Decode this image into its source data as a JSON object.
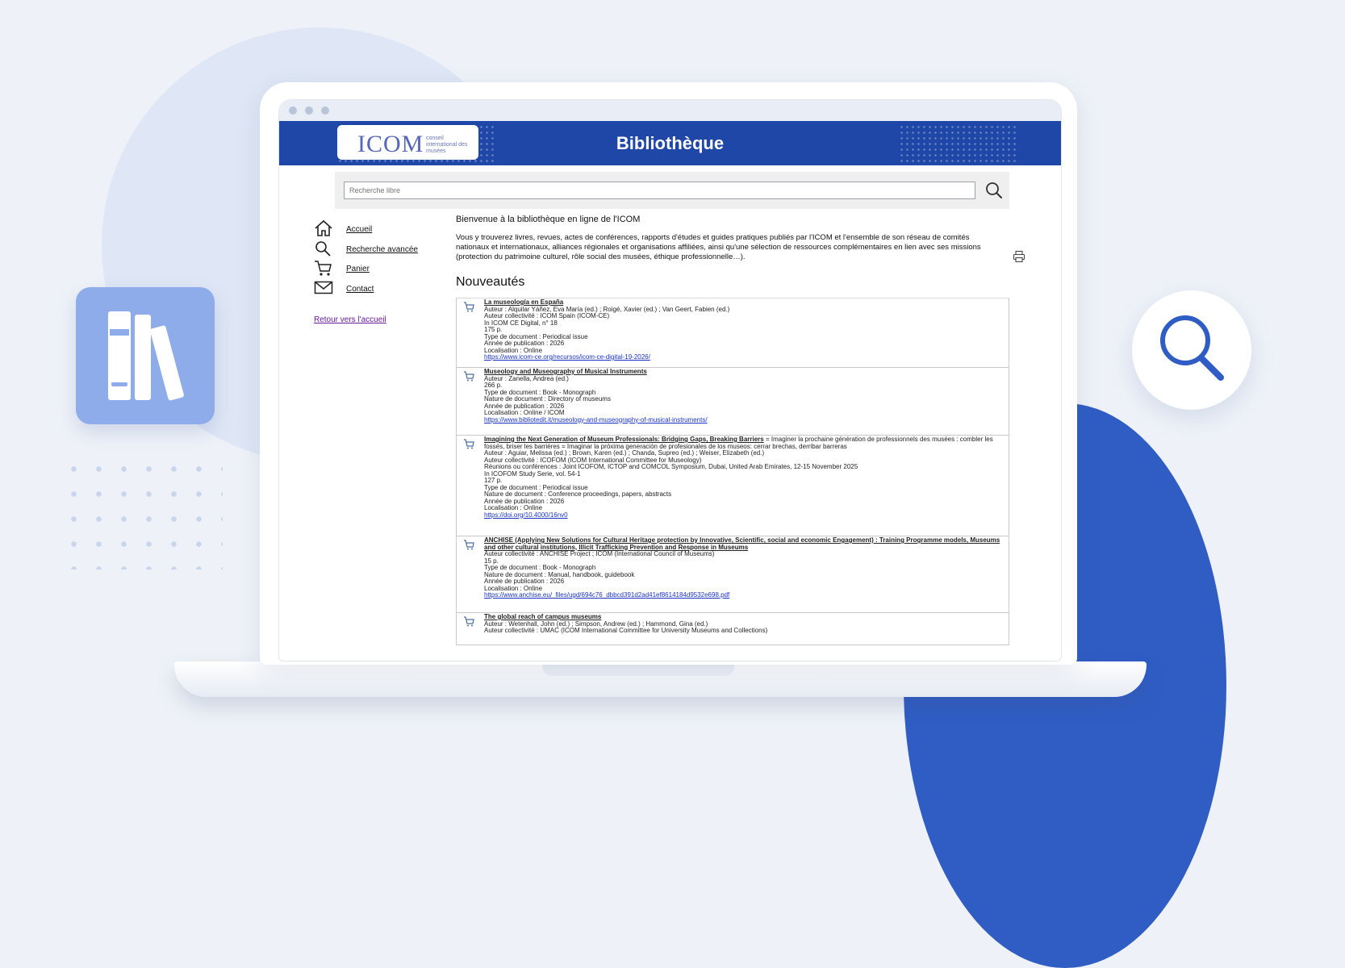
{
  "header": {
    "logo_text": "ICOM",
    "logo_sub": "conseil international des musées",
    "title": "Bibliothèque"
  },
  "search": {
    "placeholder": "Recherche libre"
  },
  "sidebar": {
    "items": [
      {
        "label": "Accueil",
        "icon": "home-icon"
      },
      {
        "label": "Recherche avancée",
        "icon": "search-icon"
      },
      {
        "label": "Panier",
        "icon": "cart-icon"
      },
      {
        "label": "Contact",
        "icon": "mail-icon"
      }
    ],
    "back_link": "Retour vers l'accueil"
  },
  "main": {
    "welcome": "Bienvenue à la bibliothèque en ligne de l'ICOM",
    "intro": "Vous y trouverez livres, revues, actes de conférences, rapports d'études et guides pratiques publiés par l'ICOM et l'ensemble de son réseau de comités nationaux et internationaux, alliances régionales et organisations affiliées, ainsi qu'une sélection de ressources complémentaires en lien avec ses missions (protection du patrimoine culturel, rôle social des musées, éthique professionnelle…).",
    "news_title": "Nouveautés"
  },
  "records": [
    {
      "title": "La museología en España",
      "title_suffix": "",
      "lines": [
        "Auteur : Alquilar Yáñez, Eva María (ed.) ; Roigé, Xavier (ed.) ; Van Geert, Fabien (ed.)",
        "Auteur collectivité : ICOM Spain (ICOM-CE)",
        "In ICOM CE Digital, n° 18",
        "175 p.",
        "Type de document : Periodical issue",
        "Année de publication : 2026",
        "Localisation : Online"
      ],
      "url": "https://www.icom-ce.org/recursos/icom-ce-digital-19-2026/"
    },
    {
      "title": "Museology and Museography of Musical Instruments",
      "title_suffix": "",
      "lines": [
        "Auteur : Zanella, Andrea (ed.)",
        "266 p.",
        "Type de document : Book - Monograph",
        "Nature de document : Directory of museums",
        "Année de publication : 2026",
        "Localisation : Online / ICOM"
      ],
      "url": "https://www.bibliotedit.it/museology-and-museography-of-musical-instruments/"
    },
    {
      "title": "Imagining the Next Generation of Museum Professionals: Bridging Gaps, Breaking Barriers",
      "title_suffix": " = Imaginer la prochaine génération de professionnels des musées : combler les fossés, briser les barrières = Imaginar la próxima generación de profesionales de los museos: cerrar brechas, derribar barreras",
      "lines": [
        "Auteur : Aguiar, Melissa (ed.) ; Brown, Karen (ed.) ; Chanda, Supreo (ed.) ; Weiser, Elizabeth (ed.)",
        "Auteur collectivité : ICOFOM (ICOM International Committee for Museology)",
        "Réunions ou conférences : Joint ICOFOM, ICTOP and COMCOL Symposium, Dubai, United Arab Emirates, 12-15 November 2025",
        "In ICOFOM Study Serie, vol. 54-1",
        "127 p.",
        "Type de document : Periodical issue",
        "Nature de document : Conference proceedings, papers, abstracts",
        "Année de publication : 2026",
        "Localisation : Online"
      ],
      "url": "https://doi.org/10.4000/16nv0"
    },
    {
      "title": "ANCHISE (Applying New Solutions for Cultural Heritage protection by Innovative, Scientific, social and economic Engagement) : Training Programme models, Museums and other cultural institutions, Illicit Trafficking Prevention and Response in Museums",
      "title_suffix": "",
      "lines": [
        "Auteur collectivité : ANCHISE Project ; ICOM (International Council of Museums)",
        "15 p.",
        "Type de document : Book - Monograph",
        "Nature de document : Manual, handbook, guidebook",
        "Année de publication : 2026",
        "Localisation : Online"
      ],
      "url": "https://www.anchise.eu/_files/ugd/694c76_dbbcd391d2ad41ef8614184d9532e698.pdf"
    },
    {
      "title": "The global reach of campus museums",
      "title_suffix": "",
      "lines": [
        "Auteur : Wetenhall, John (ed.) ; Simpson, Andrew (ed.) ; Hammond, Gina (ed.)",
        "Auteur collectivité : UMAC (ICOM International Committee for University Museums and Collections)"
      ],
      "url": ""
    }
  ],
  "colors": {
    "header_blue": "#1f47a7",
    "accent_blue": "#2f5dc4",
    "link_blue": "#1a33c9",
    "visited": "#6a1b9a"
  }
}
